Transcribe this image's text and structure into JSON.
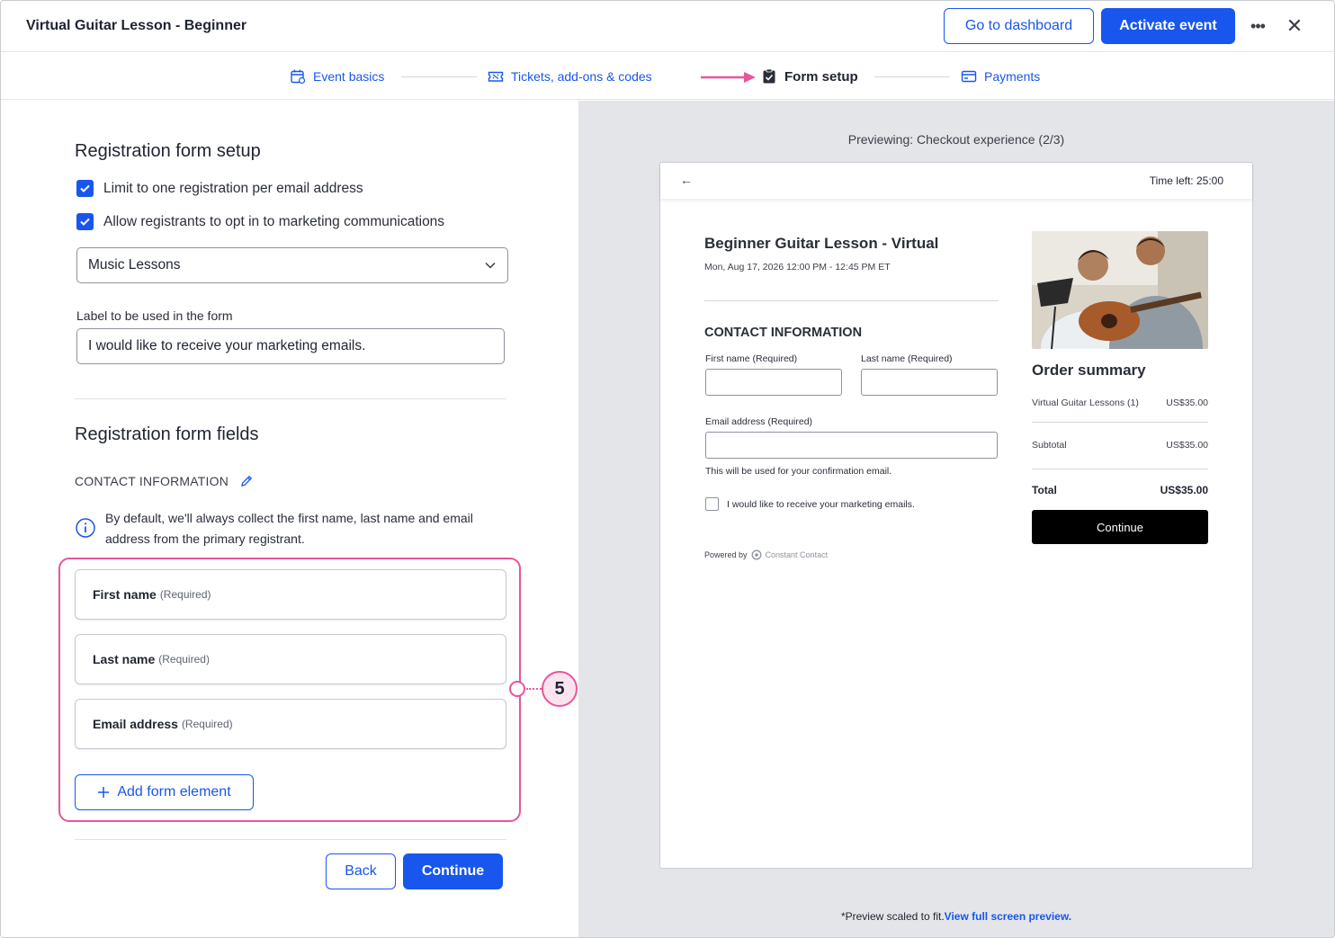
{
  "header": {
    "title": "Virtual Guitar Lesson - Beginner",
    "dashboard_label": "Go to dashboard",
    "activate_label": "Activate event",
    "more_icon": "more-icon",
    "close_icon": "close-icon"
  },
  "stepper": {
    "steps": [
      {
        "label": "Event basics",
        "icon": "calendar-icon"
      },
      {
        "label": "Tickets, add-ons & codes",
        "icon": "ticket-icon"
      },
      {
        "label": "Form setup",
        "icon": "clipboard-check-icon"
      },
      {
        "label": "Payments",
        "icon": "card-icon"
      }
    ],
    "active_index": 2
  },
  "form_setup": {
    "title": "Registration form setup",
    "limit_checkbox": {
      "label": "Limit to one registration per email address",
      "checked": true
    },
    "optin_checkbox": {
      "label": "Allow registrants to opt in to marketing communications",
      "checked": true
    },
    "list_select": {
      "value": "Music Lessons"
    },
    "label_field": {
      "label": "Label to be used in the form",
      "value": "I would like to receive your marketing emails."
    }
  },
  "form_fields": {
    "title": "Registration form fields",
    "section_label": "CONTACT INFORMATION",
    "info_text": "By default, we'll always collect the first name, last name and email address from the primary registrant.",
    "fields": [
      {
        "label": "First name",
        "req": "(Required)"
      },
      {
        "label": "Last name",
        "req": "(Required)"
      },
      {
        "label": "Email address",
        "req": "(Required)"
      }
    ],
    "add_label": "Add form element",
    "callout_number": "5"
  },
  "footer": {
    "back_label": "Back",
    "continue_label": "Continue"
  },
  "preview": {
    "title": "Previewing: Checkout experience (2/3)",
    "time_left": "Time left: 25:00",
    "event_name": "Beginner Guitar Lesson - Virtual",
    "event_date": "Mon, Aug 17, 2026 12:00 PM - 12:45 PM ET",
    "contact_heading": "CONTACT INFORMATION",
    "first_label": "First name  (Required)",
    "last_label": "Last name  (Required)",
    "email_label": "Email address  (Required)",
    "email_help": "This will be used for your confirmation email.",
    "optin_label": "I would like to receive your marketing emails.",
    "powered_by": "Powered by",
    "powered_brand": "Constant Contact",
    "order_title": "Order summary",
    "item_name": "Virtual Guitar Lessons (1)",
    "item_price": "US$35.00",
    "subtotal_label": "Subtotal",
    "subtotal_value": "US$35.00",
    "total_label": "Total",
    "total_value": "US$35.00",
    "continue_label": "Continue",
    "footnote": "*Preview scaled to fit.",
    "footnote_link": "View full screen preview."
  },
  "colors": {
    "accent": "#1856ed",
    "highlight": "#e8559a"
  }
}
